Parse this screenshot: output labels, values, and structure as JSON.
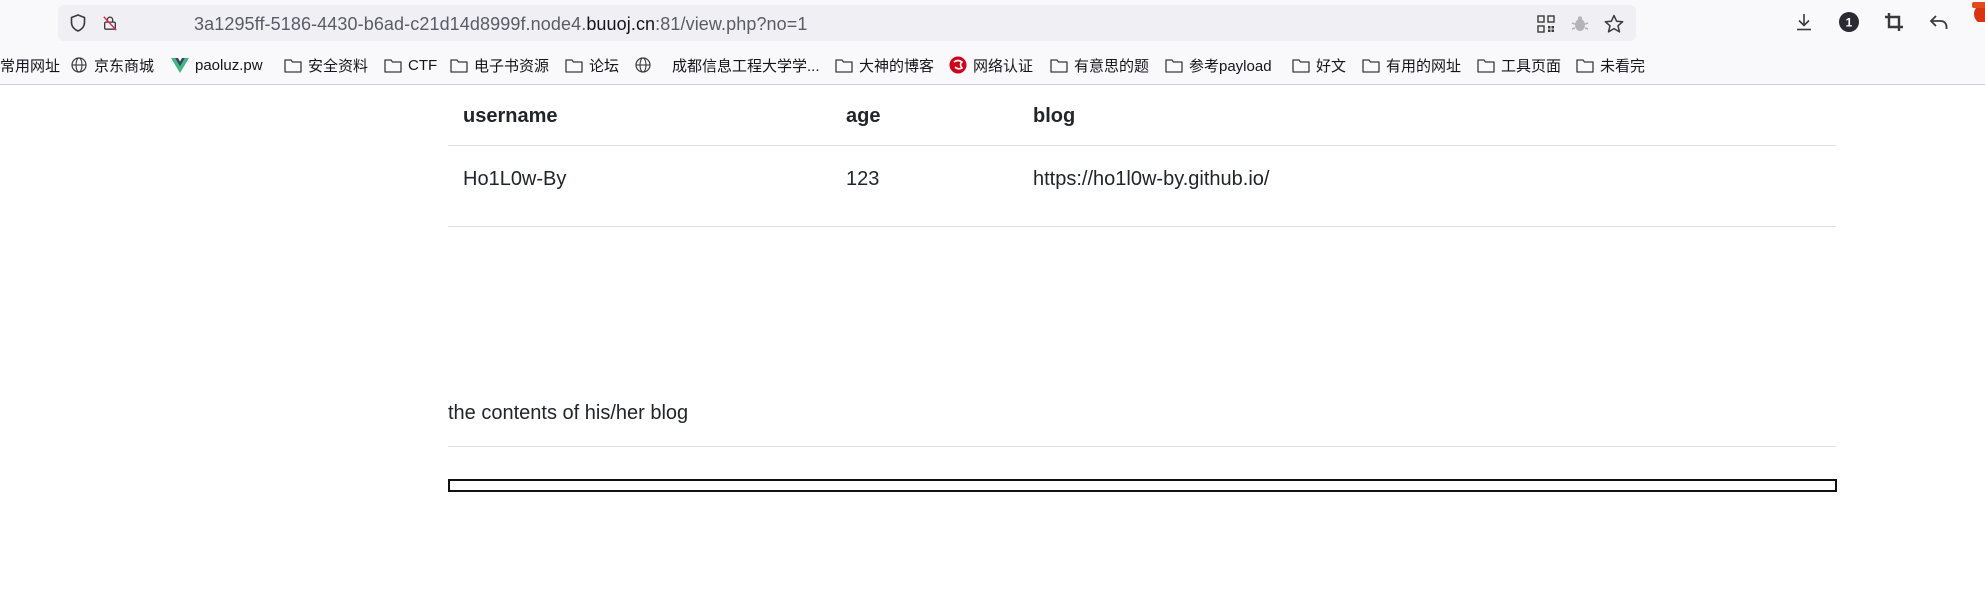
{
  "browser": {
    "url_prefix": "3a1295ff-5186-4430-b6ad-c21d14d8999f.node4.",
    "url_host": "buuoj.cn",
    "url_suffix": ":81/view.php?no=1",
    "icons": {
      "shield": "shield-icon",
      "lock": "insecure-lock-icon",
      "qr": "qr-code-icon",
      "ext": "extension-bug-icon",
      "star": "bookmark-star-icon",
      "download": "download-icon",
      "badge": "notification-1-icon",
      "crop": "screenshot-crop-icon",
      "back": "undo-arrow-icon"
    }
  },
  "bookmarks": [
    {
      "label": "常用网址",
      "icon": "none"
    },
    {
      "label": "京东商城",
      "icon": "globe"
    },
    {
      "label": "paoluz.pw",
      "icon": "vue"
    },
    {
      "label": "安全资料",
      "icon": "folder"
    },
    {
      "label": "CTF",
      "icon": "folder"
    },
    {
      "label": "电子书资源",
      "icon": "folder"
    },
    {
      "label": "论坛",
      "icon": "folder"
    },
    {
      "label": "成都信息工程大学学...",
      "icon": "globe"
    },
    {
      "label": "大神的博客",
      "icon": "folder"
    },
    {
      "label": "网络认证",
      "icon": "red-logo"
    },
    {
      "label": "有意思的题",
      "icon": "folder"
    },
    {
      "label": "参考payload",
      "icon": "folder"
    },
    {
      "label": "好文",
      "icon": "folder"
    },
    {
      "label": "有用的网址",
      "icon": "folder"
    },
    {
      "label": "工具页面",
      "icon": "folder"
    },
    {
      "label": "未看完",
      "icon": "folder"
    }
  ],
  "table": {
    "headers": [
      "username",
      "age",
      "blog"
    ],
    "rows": [
      [
        "Ho1L0w-By",
        "123",
        "https://ho1l0w-by.github.io/"
      ]
    ]
  },
  "blog_note": "the contents of his/her blog"
}
